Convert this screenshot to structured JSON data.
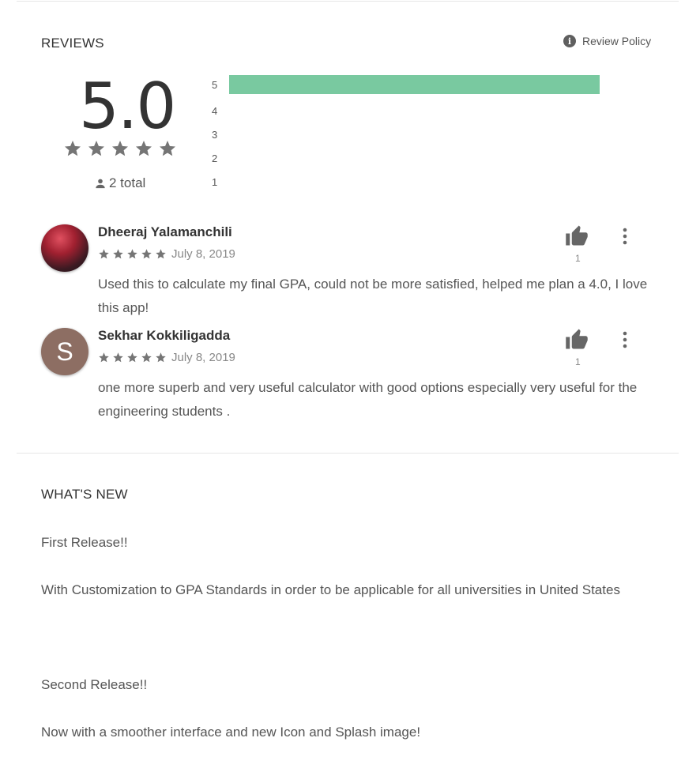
{
  "reviews_section": {
    "title": "REVIEWS",
    "review_policy_label": "Review Policy",
    "average_score": "5.0",
    "average_stars": 5,
    "total_label": "2 total",
    "histogram": [
      {
        "label": "5",
        "fraction": 1.0
      },
      {
        "label": "4",
        "fraction": 0.0
      },
      {
        "label": "3",
        "fraction": 0.0
      },
      {
        "label": "2",
        "fraction": 0.0
      },
      {
        "label": "1",
        "fraction": 0.0
      }
    ],
    "histogram_color": "#79c9a0",
    "reviews": [
      {
        "name": "Dheeraj Yalamanchili",
        "rating": 5,
        "date": "July 8, 2019",
        "text": "Used this to calculate my final GPA, could not be more satisfied, helped me plan a 4.0, I love this app!",
        "helpful_count": "1",
        "avatar_type": "photo"
      },
      {
        "name": "Sekhar Kokkiligadda",
        "rating": 5,
        "date": "July 8, 2019",
        "text": "one more superb and very useful calculator with good options especially very useful for the engineering students .",
        "helpful_count": "1",
        "avatar_type": "letter",
        "avatar_letter": "S",
        "avatar_color": "#8d6e63"
      }
    ]
  },
  "whats_new": {
    "title": "WHAT'S NEW",
    "lines": [
      "First Release!!",
      "With Customization to GPA Standards in order to be applicable for all universities in United States",
      "",
      "Second Release!!",
      "Now with a smoother interface and new Icon and Splash image!"
    ]
  }
}
